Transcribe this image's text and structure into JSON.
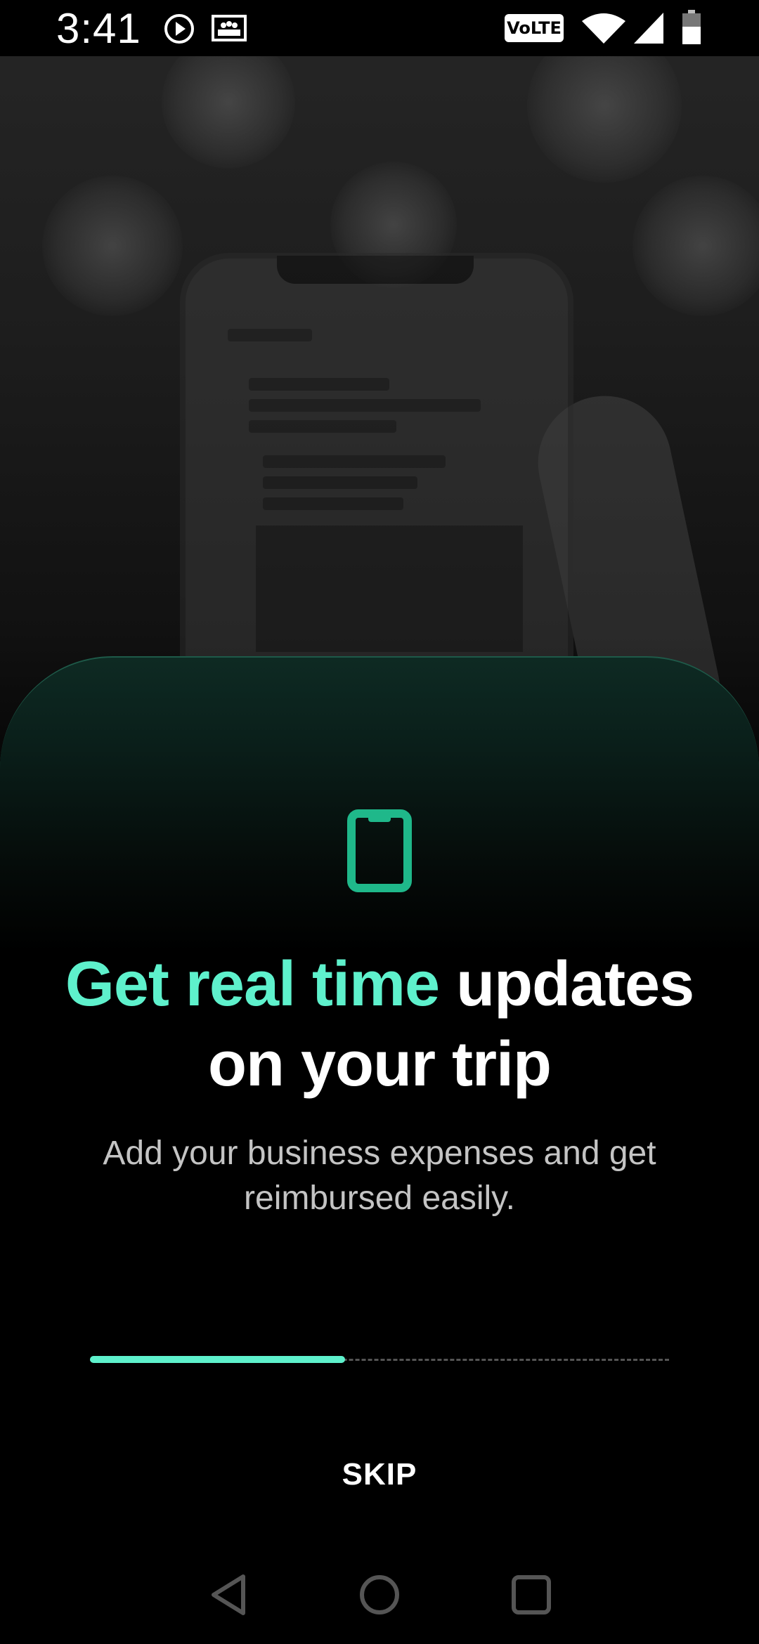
{
  "status_bar": {
    "time": "3:41",
    "network_badge": "VoLTE",
    "icons": [
      "play-icon",
      "media-icon",
      "wifi-icon",
      "signal-icon",
      "battery-icon"
    ]
  },
  "onboarding": {
    "feature_icon": "smartphone-icon",
    "headline_accent": "Get real time",
    "headline_rest": "updates on your trip",
    "subtitle": "Add your business expenses and get reimbursed easily.",
    "progress": 0.44,
    "skip_label": "SKIP"
  },
  "nav_bar": {
    "buttons": [
      "back-icon",
      "home-icon",
      "recents-icon"
    ]
  },
  "colors": {
    "accent": "#5ef1cc",
    "icon_green": "#1fb88a",
    "background": "#000000",
    "subtitle": "#c4c4c4"
  }
}
